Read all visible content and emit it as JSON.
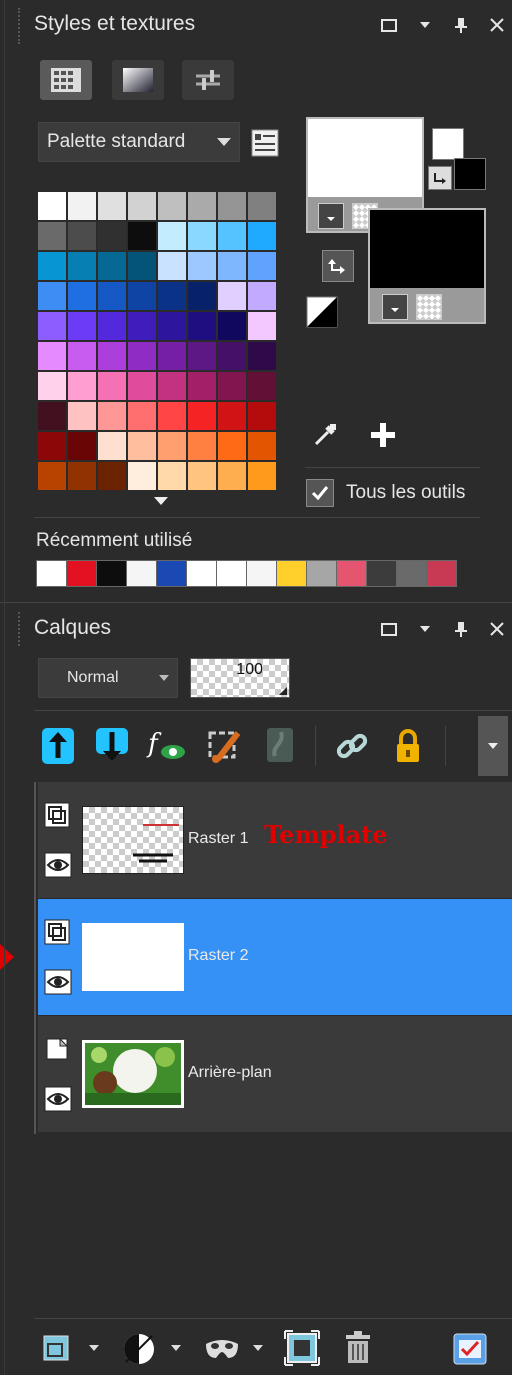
{
  "styles_panel": {
    "title": "Styles et textures",
    "palette_select": "Palette standard",
    "all_tools_label": "Tous les outils",
    "all_tools_checked": true,
    "recent_label": "Récemment utilisé",
    "palette_rows": [
      [
        "#ffffff",
        "#f2f2f2",
        "#e0e0e0",
        "#d2d2d2",
        "#bfbfbf",
        "#aaaaaa",
        "#959595",
        "#808080"
      ],
      [
        "#6a6a6a",
        "#4c4c4c",
        "#303030",
        "#0d0d0d",
        "#c3ecff",
        "#8ad8ff",
        "#55c3ff",
        "#20aaff"
      ],
      [
        "#0895d4",
        "#077fb3",
        "#056994",
        "#045378",
        "#c8e2ff",
        "#9cc8ff",
        "#7fb7ff",
        "#5fa3ff"
      ],
      [
        "#3d8df5",
        "#1f6fe3",
        "#1658c4",
        "#0f43a4",
        "#0a3286",
        "#08226a",
        "#dfd0ff",
        "#c1aaff"
      ],
      [
        "#8d5dff",
        "#6b3bf5",
        "#5329db",
        "#3f1dbd",
        "#2e159e",
        "#1f0e7f",
        "#10075f",
        "#f3c7ff"
      ],
      [
        "#e58bff",
        "#c95cf0",
        "#ac3fdc",
        "#8f2cc4",
        "#751fa6",
        "#5d1886",
        "#451168",
        "#2e0a4a"
      ],
      [
        "#ffd1ea",
        "#ff9fd1",
        "#f570b5",
        "#df4c9c",
        "#c33181",
        "#a31f68",
        "#82154f",
        "#621035"
      ],
      [
        "#431020",
        "#ffc2c2",
        "#ff9797",
        "#ff6f6f",
        "#ff4545",
        "#f52323",
        "#d01313",
        "#b40c0c"
      ],
      [
        "#8c0808",
        "#6a0505",
        "#ffdfcf",
        "#ffbf9f",
        "#ff9f6f",
        "#ff8040",
        "#ff6a14",
        "#e35500"
      ],
      [
        "#b84300",
        "#913300",
        "#6c2400",
        "#ffeedd",
        "#ffd9aa",
        "#ffc47f",
        "#ffae4f",
        "#ff9a1c"
      ]
    ],
    "recent_colors": [
      "#ffffff",
      "#e31222",
      "#0d0d0d",
      "#f5f5f5",
      "#1b49b4",
      "#ffffff",
      "#ffffff",
      "#f5f5f5",
      "#ffd02b",
      "#a6a6a6",
      "#e6556f",
      "#3c3c3c",
      "#6a6a6a",
      "#c83954"
    ],
    "foreground_color": "#ffffff",
    "background_color": "#000000"
  },
  "layers_panel": {
    "title": "Calques",
    "blend_mode": "Normal",
    "opacity": "100",
    "layers": [
      {
        "name": "Raster 1",
        "annotation": "Template",
        "selected": false
      },
      {
        "name": "Raster 2",
        "selected": true
      },
      {
        "name": "Arrière-plan",
        "selected": false
      }
    ]
  },
  "colors": {
    "selection": "#3591f5",
    "annotation": "#e00000",
    "cyan_icon": "#22c3ff"
  }
}
